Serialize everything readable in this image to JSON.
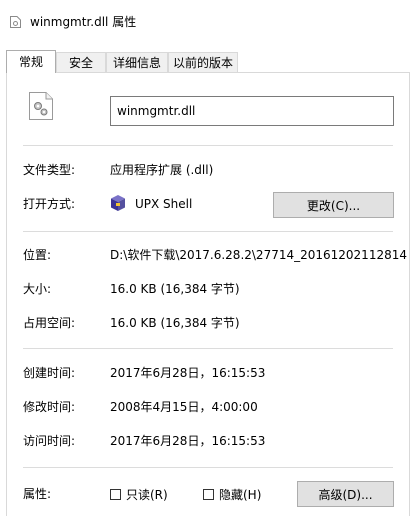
{
  "window": {
    "title": "winmgmtr.dll 属性"
  },
  "tabs": [
    {
      "label": "常规",
      "active": true
    },
    {
      "label": "安全",
      "active": false
    },
    {
      "label": "详细信息",
      "active": false
    },
    {
      "label": "以前的版本",
      "active": false
    }
  ],
  "general": {
    "file_name": "winmgmtr.dll",
    "file_type": {
      "label": "文件类型:",
      "value": "应用程序扩展 (.dll)"
    },
    "opens_with": {
      "label": "打开方式:",
      "app": "UPX Shell",
      "change_button": "更改(C)..."
    },
    "location": {
      "label": "位置:",
      "value": "D:\\软件下载\\2017.6.28.2\\27714_20161202112814"
    },
    "size": {
      "label": "大小:",
      "value": "16.0 KB (16,384 字节)"
    },
    "size_on_disk": {
      "label": "占用空间:",
      "value": "16.0 KB (16,384 字节)"
    },
    "created": {
      "label": "创建时间:",
      "value": "2017年6月28日，16:15:53"
    },
    "modified": {
      "label": "修改时间:",
      "value": "2008年4月15日，4:00:00"
    },
    "accessed": {
      "label": "访问时间:",
      "value": "2017年6月28日，16:15:53"
    },
    "attributes": {
      "label": "属性:",
      "readonly": {
        "label": "只读(R)",
        "checked": false
      },
      "hidden": {
        "label": "隐藏(H)",
        "checked": false
      },
      "advanced_button": "高级(D)..."
    }
  },
  "icons": {
    "title": "dll-file-icon",
    "file": "dll-gear-file-icon",
    "app": "upx-shell-app-icon"
  }
}
